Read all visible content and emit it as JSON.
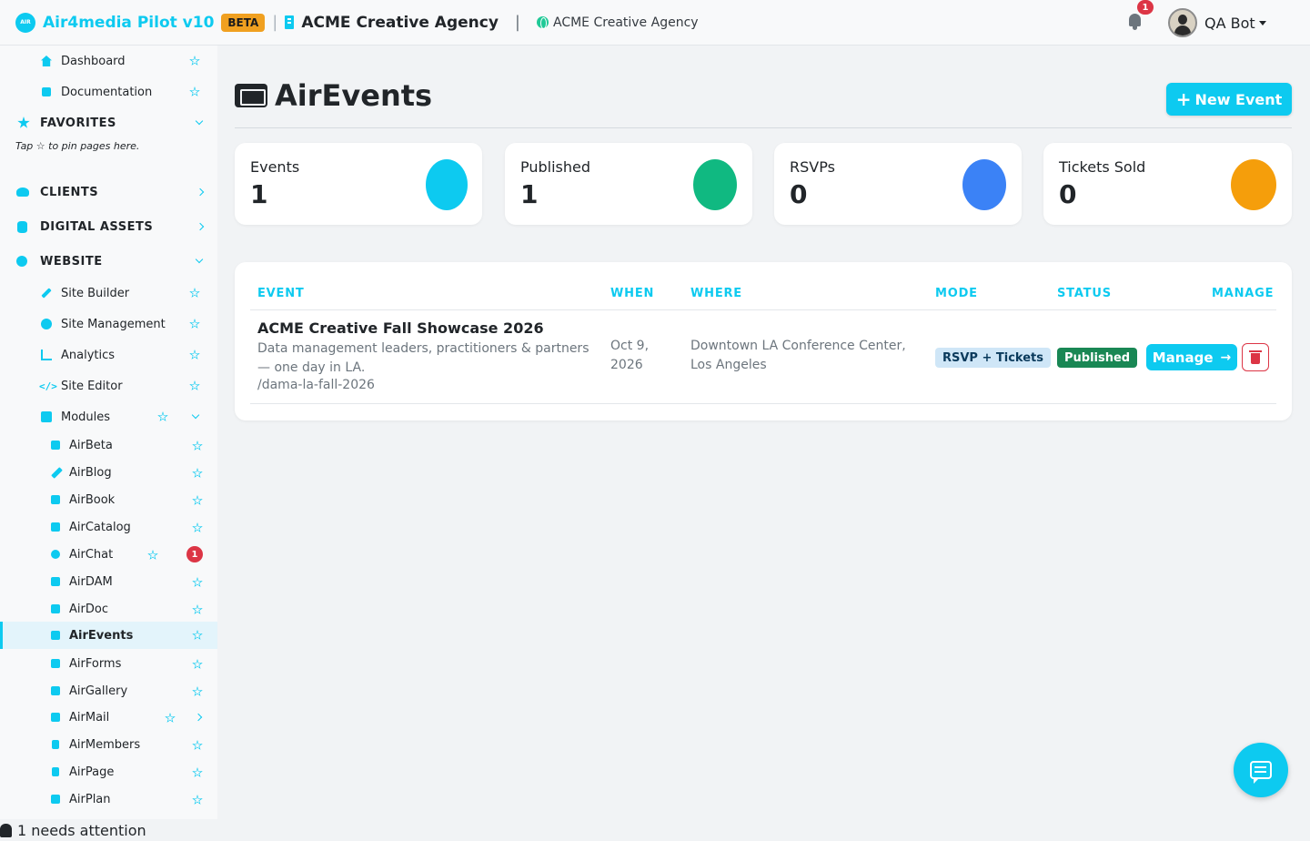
{
  "header": {
    "logo_text": "AIR",
    "app_title": "Air4media Pilot v10",
    "beta_label": "BETA",
    "org_name": "ACME Creative Agency",
    "site_name": "ACME Creative Agency",
    "notification_count": "1",
    "user_name": "QA Bot"
  },
  "sidebar": {
    "dashboard": "Dashboard",
    "documentation": "Documentation",
    "favorites": "FAVORITES",
    "favorites_hint": "Tap ☆ to pin pages here.",
    "clients": "CLIENTS",
    "digital_assets": "DIGITAL ASSETS",
    "website": "WEBSITE",
    "site_builder": "Site Builder",
    "site_management": "Site Management",
    "analytics": "Analytics",
    "site_editor": "Site Editor",
    "modules": "Modules",
    "module_items": [
      "AirBeta",
      "AirBlog",
      "AirBook",
      "AirCatalog",
      "AirChat",
      "AirDAM",
      "AirDoc",
      "AirEvents",
      "AirForms",
      "AirGallery",
      "AirMail",
      "AirMembers",
      "AirPage",
      "AirPlan"
    ],
    "active_module": "AirEvents",
    "airchat_badge": "1"
  },
  "footer": {
    "attention_text": "1 needs attention"
  },
  "page": {
    "title": "AirEvents",
    "new_button": "New Event"
  },
  "stats": [
    {
      "label": "Events",
      "value": "1",
      "color": "#0dcaf0"
    },
    {
      "label": "Published",
      "value": "1",
      "color": "#10b981"
    },
    {
      "label": "RSVPs",
      "value": "0",
      "color": "#3b82f6"
    },
    {
      "label": "Tickets Sold",
      "value": "0",
      "color": "#f59e0b"
    }
  ],
  "table": {
    "headers": {
      "event": "EVENT",
      "when": "WHEN",
      "where": "WHERE",
      "mode": "MODE",
      "status": "STATUS",
      "manage": "MANAGE"
    },
    "rows": [
      {
        "name": "ACME Creative Fall Showcase 2026",
        "description": "Data management leaders, practitioners & partners — one day in LA.",
        "slug": "/dama-la-fall-2026",
        "when": "Oct 9, 2026",
        "where": "Downtown LA Conference Center, Los Angeles",
        "mode": "RSVP + Tickets",
        "status": "Published",
        "manage_label": "Manage"
      }
    ]
  },
  "colors": {
    "accent": "#0dcaf0",
    "danger": "#dc3545",
    "success": "#198754",
    "beta": "#f0a020"
  },
  "icons": [
    "ticket-icon",
    "bell-icon",
    "chat-icon",
    "trash-icon",
    "star-icon",
    "globe-icon",
    "building-icon"
  ]
}
